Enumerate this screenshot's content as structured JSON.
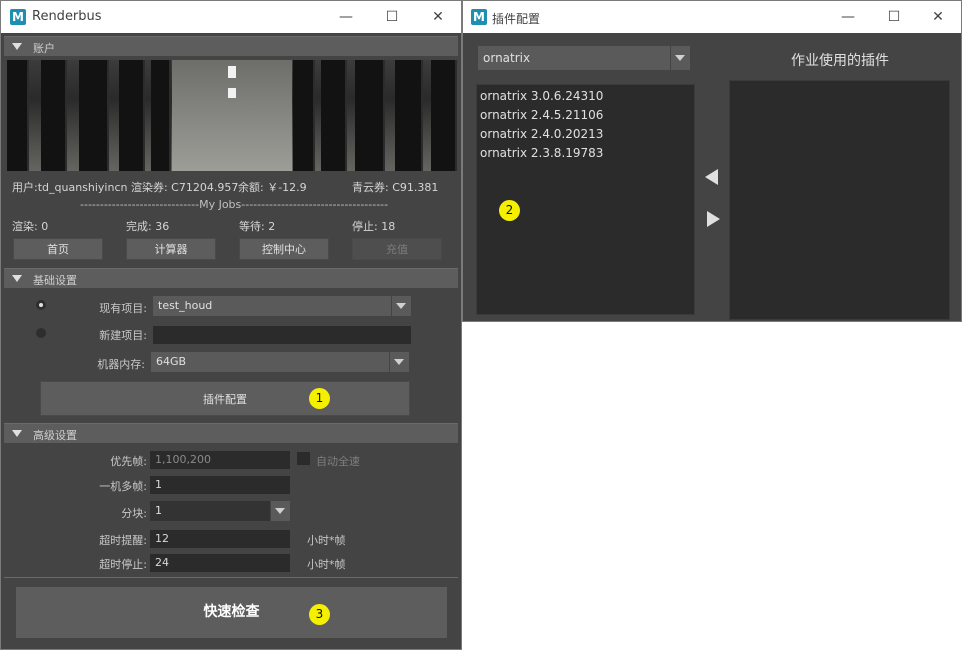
{
  "main_window": {
    "title": "Renderbus",
    "app_icon": "M",
    "section_account": "账户",
    "user_line": "用户:td_quanshiyincn 渲染券: C71204.957",
    "balance": "余额: ￥-12.9",
    "qingyun": "青云券: C91.381",
    "jobs_separator": "------------------------------My Jobs-------------------------------------",
    "stats": {
      "rendering": "渲染: 0",
      "done": "完成: 36",
      "waiting": "等待: 2",
      "stopped": "停止: 18"
    },
    "buttons": {
      "home": "首页",
      "calculator": "计算器",
      "control_center": "控制中心",
      "recharge": "充值"
    },
    "section_basic": "基础设置",
    "existing_project_label": "现有项目:",
    "existing_project_value": "test_houd",
    "new_project_label": "新建项目:",
    "new_project_value": "",
    "memory_label": "机器内存:",
    "memory_value": "64GB",
    "plugin_config_button": "插件配置",
    "badge1": "1",
    "section_advanced": "高级设置",
    "priority_frames_label": "优先帧:",
    "priority_frames_value": "1,100,200",
    "auto_full_speed": "自动全速",
    "multi_frame_label": "一机多帧:",
    "multi_frame_value": "1",
    "split_label": "分块:",
    "split_value": "1",
    "timeout_remind_label": "超时提醒:",
    "timeout_remind_value": "12",
    "timeout_remind_unit": "小时*帧",
    "timeout_stop_label": "超时停止:",
    "timeout_stop_value": "24",
    "timeout_stop_unit": "小时*帧",
    "quick_check_button": "快速检查",
    "badge3": "3"
  },
  "plugin_window": {
    "title": "插件配置",
    "app_icon": "M",
    "plugin_select_value": "ornatrix",
    "used_plugins_title": "作业使用的插件",
    "available_plugins": [
      "ornatrix 3.0.6.24310",
      "ornatrix 2.4.5.21106",
      "ornatrix 2.4.0.20213",
      "ornatrix 2.3.8.19783"
    ],
    "badge2": "2"
  },
  "window_controls": {
    "minimize": "—",
    "maximize": "☐",
    "close": "✕"
  },
  "colors": {
    "panel_bg": "#444444",
    "badge": "#f5f000",
    "field_bg": "#2b2b2b",
    "button_bg": "#5d5d5d"
  }
}
